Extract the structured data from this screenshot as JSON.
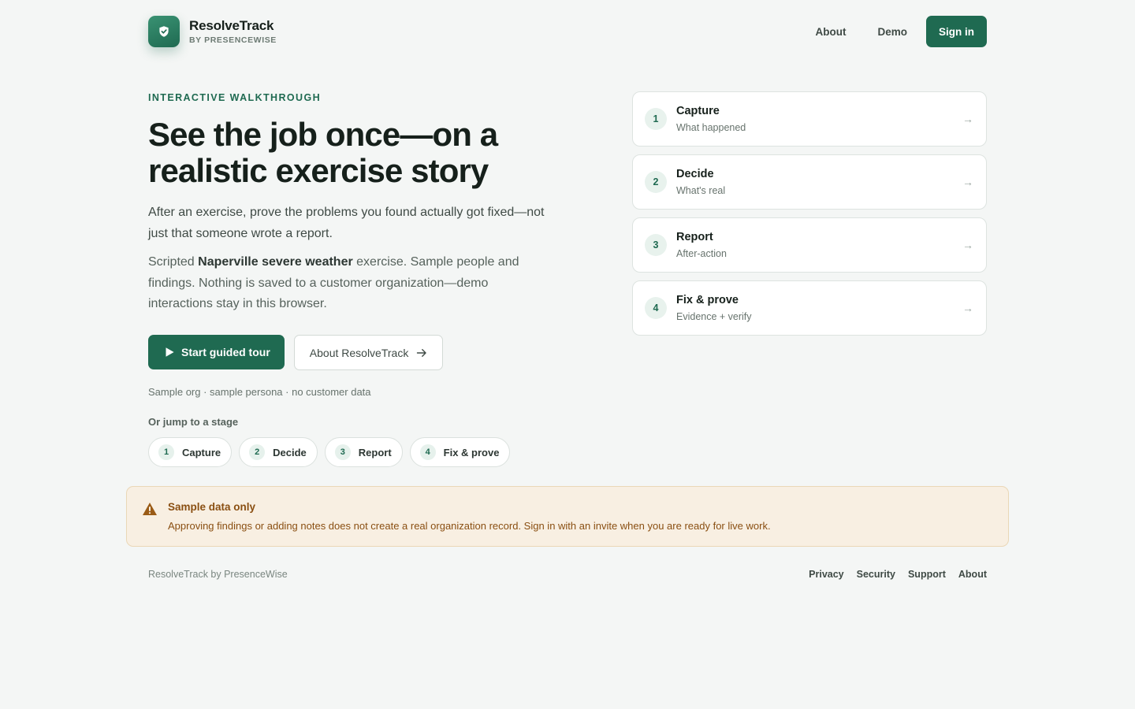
{
  "header": {
    "brand_name": "ResolveTrack",
    "brand_sub": "BY PRESENCEWISE",
    "nav": {
      "about": "About",
      "demo": "Demo"
    },
    "signin_label": "Sign in"
  },
  "hero": {
    "eyebrow": "INTERACTIVE WALKTHROUGH",
    "headline": "See the job once—on a realistic exercise story",
    "lede": "After an exercise, prove the problems you found actually got fixed—not just that someone wrote a report.",
    "lede2_prefix": "Scripted ",
    "lede2_strong": "Naperville severe weather",
    "lede2_suffix": " exercise. Sample people and findings. Nothing is saved to a customer organization—demo interactions stay in this browser.",
    "primary_cta": "Start guided tour",
    "secondary_cta": "About ResolveTrack",
    "meta": "Sample org · sample persona · no customer data",
    "jump_label": "Or jump to a stage",
    "chips": [
      {
        "num": "1",
        "label": "Capture"
      },
      {
        "num": "2",
        "label": "Decide"
      },
      {
        "num": "3",
        "label": "Report"
      },
      {
        "num": "4",
        "label": "Fix & prove"
      }
    ]
  },
  "stages": [
    {
      "num": "1",
      "title": "Capture",
      "sub": "What happened"
    },
    {
      "num": "2",
      "title": "Decide",
      "sub": "What's real"
    },
    {
      "num": "3",
      "title": "Report",
      "sub": "After-action"
    },
    {
      "num": "4",
      "title": "Fix & prove",
      "sub": "Evidence + verify"
    }
  ],
  "notice": {
    "title": "Sample data only",
    "body": "Approving findings or adding notes does not create a real organization record. Sign in with an invite when you are ready for live work."
  },
  "footer": {
    "brand": "ResolveTrack by PresenceWise",
    "links": [
      "Privacy",
      "Security",
      "Support",
      "About"
    ]
  },
  "colors": {
    "brand": "#1f6a51",
    "background": "#f4f6f5",
    "warning_bg": "#f8efe2",
    "warning_text": "#8a4f12"
  },
  "icons": {
    "logo": "shield-check-icon",
    "play": "play-icon",
    "arrow": "arrow-right-icon",
    "warning": "warning-triangle-icon"
  }
}
